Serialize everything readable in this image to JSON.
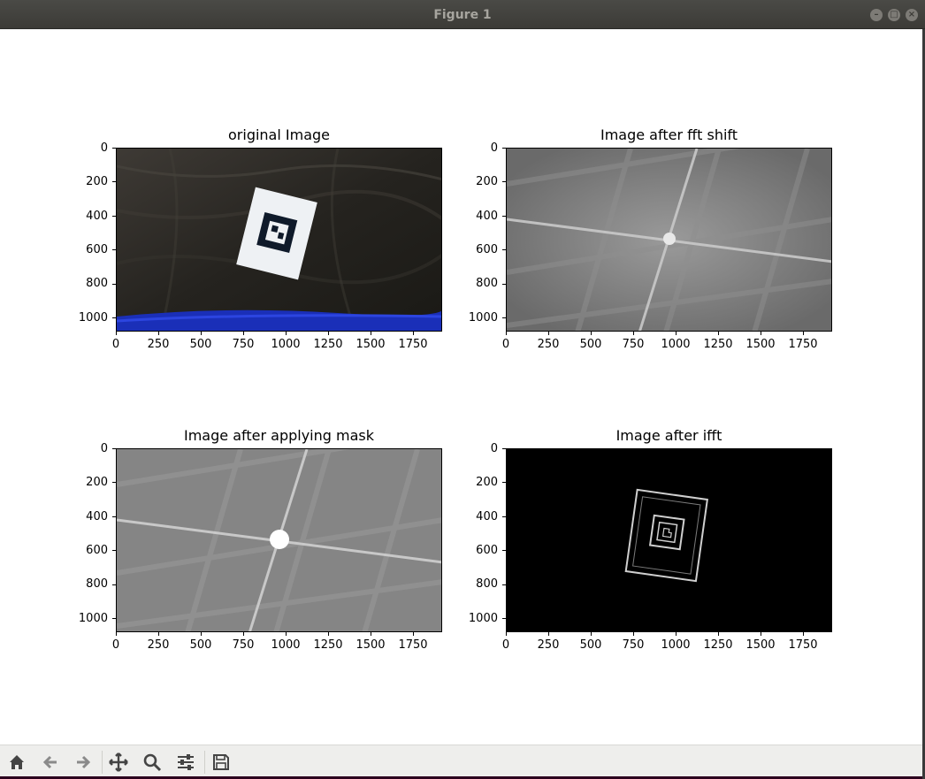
{
  "window": {
    "title": "Figure 1",
    "controls": [
      "minimize-icon",
      "maximize-icon",
      "close-icon"
    ]
  },
  "subplots": [
    {
      "title": "original Image",
      "x_ticks": [
        "0",
        "250",
        "500",
        "750",
        "1000",
        "1250",
        "1500",
        "1750"
      ],
      "y_ticks": [
        "0",
        "200",
        "400",
        "600",
        "800",
        "1000"
      ]
    },
    {
      "title": "Image after fft shift",
      "x_ticks": [
        "0",
        "250",
        "500",
        "750",
        "1000",
        "1250",
        "1500",
        "1750"
      ],
      "y_ticks": [
        "0",
        "200",
        "400",
        "600",
        "800",
        "1000"
      ]
    },
    {
      "title": "Image after applying mask",
      "x_ticks": [
        "0",
        "250",
        "500",
        "750",
        "1000",
        "1250",
        "1500",
        "1750"
      ],
      "y_ticks": [
        "0",
        "200",
        "400",
        "600",
        "800",
        "1000"
      ]
    },
    {
      "title": "Image after ifft",
      "x_ticks": [
        "0",
        "250",
        "500",
        "750",
        "1000",
        "1250",
        "1500",
        "1750"
      ],
      "y_ticks": [
        "0",
        "200",
        "400",
        "600",
        "800",
        "1000"
      ]
    }
  ],
  "axis": {
    "x_limits": [
      0,
      1920
    ],
    "y_limits": [
      1080,
      0
    ],
    "x_tick_values": [
      0,
      250,
      500,
      750,
      1000,
      1250,
      1500,
      1750
    ],
    "y_tick_values": [
      0,
      200,
      400,
      600,
      800,
      1000
    ]
  },
  "toolbar": {
    "buttons": [
      "home-icon",
      "back-icon",
      "forward-icon",
      "pan-icon",
      "zoom-icon",
      "configure-subplots-icon",
      "save-icon"
    ]
  },
  "colors": {
    "titlebar": "#3c3b37",
    "toolbar": "#eeeeec",
    "canvas": "#ffffff"
  }
}
